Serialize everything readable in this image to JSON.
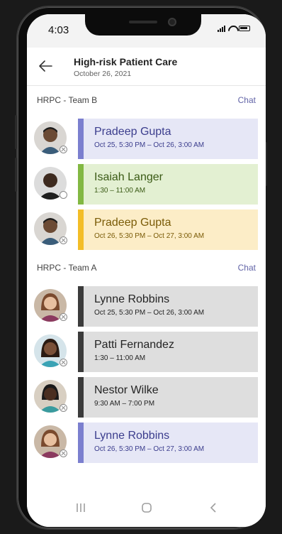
{
  "status": {
    "time": "4:03"
  },
  "header": {
    "title": "High-risk Patient Care",
    "date": "October 26, 2021"
  },
  "sections": [
    {
      "title": "HRPC - Team B",
      "chat_label": "Chat",
      "shifts": [
        {
          "name": "Pradeep Gupta",
          "time": "Oct 25, 5:30 PM – Oct 26, 3:00 AM",
          "color": "#7b7fcf",
          "presence": "offline"
        },
        {
          "name": "Isaiah Langer",
          "time": "1:30 – 11:00 AM",
          "color": "#82b842",
          "presence": "unknown"
        },
        {
          "name": "Pradeep Gupta",
          "time": "Oct 26, 5:30 PM – Oct 27, 3:00 AM",
          "color": "#f3bd27",
          "presence": "offline"
        }
      ]
    },
    {
      "title": "HRPC - Team A",
      "chat_label": "Chat",
      "shifts": [
        {
          "name": "Lynne Robbins",
          "time": "Oct 25, 5:30 PM – Oct 26, 3:00 AM",
          "color": "#3b3b3b",
          "presence": "offline"
        },
        {
          "name": "Patti Fernandez",
          "time": "1:30 – 11:00 AM",
          "color": "#3b3b3b",
          "presence": "offline"
        },
        {
          "name": "Nestor Wilke",
          "time": "9:30 AM – 7:00 PM",
          "color": "#3b3b3b",
          "presence": "offline"
        },
        {
          "name": "Lynne Robbins",
          "time": "Oct 26, 5:30 PM – Oct 27, 3:00 AM",
          "color": "#7b7fcf",
          "presence": "offline"
        }
      ]
    }
  ],
  "icons": {
    "back": "arrow-left-icon",
    "nav": [
      "recent-apps-icon",
      "home-icon",
      "back-nav-icon"
    ]
  }
}
